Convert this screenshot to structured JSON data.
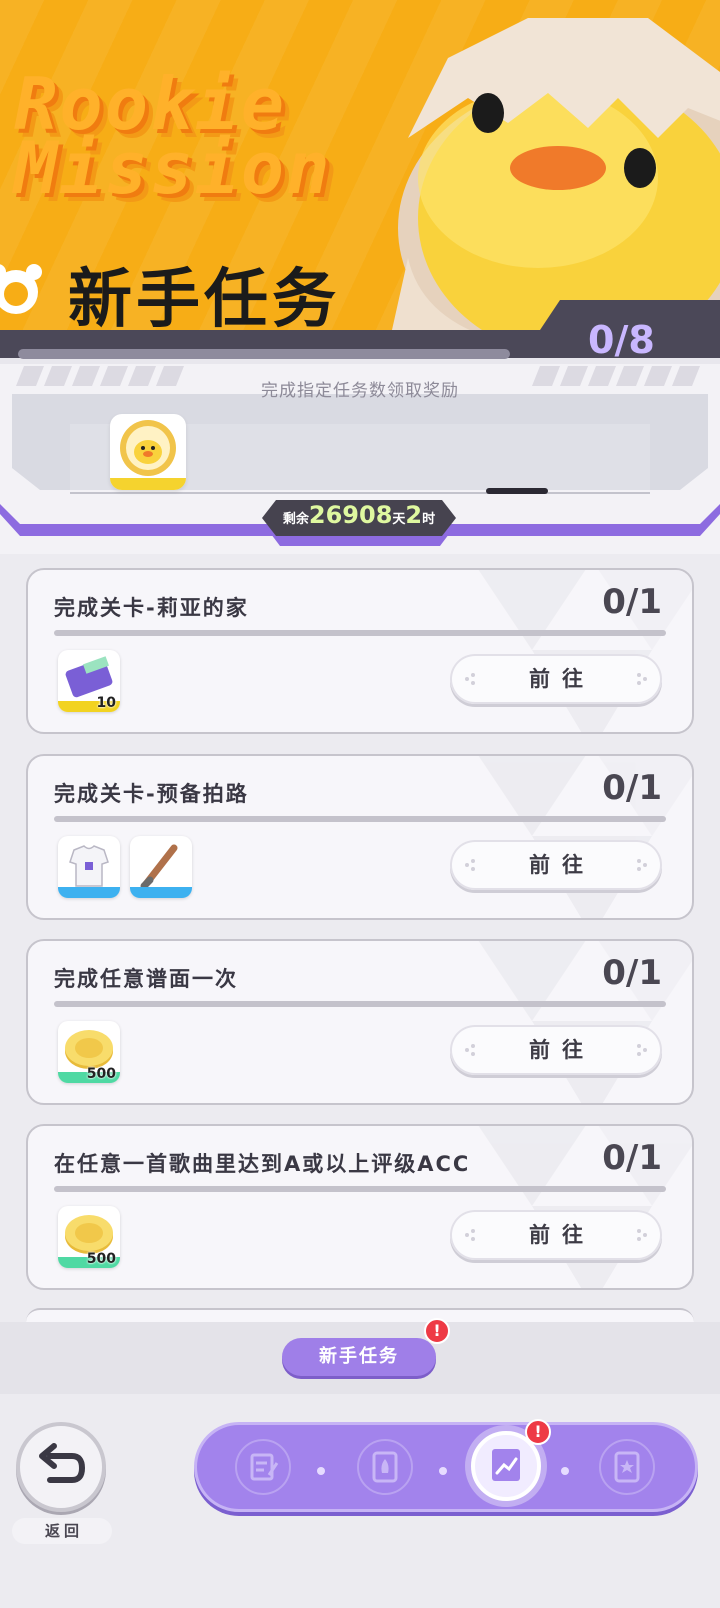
{
  "hero": {
    "title_en": "Rookie Mission",
    "title_cn": "新手任务",
    "progress": "0/8",
    "progress_fraction": 0.0
  },
  "panel": {
    "hint": "完成指定任务数领取奖励",
    "timer_prefix": "剩余",
    "timer_days": "26908",
    "timer_days_unit": "天",
    "timer_hours": "2",
    "timer_hours_unit": "时"
  },
  "tasks": [
    {
      "title": "完成关卡-莉亚的家",
      "progress": "0/1",
      "button": "前往",
      "rewards": [
        {
          "icon": "ticket-icon",
          "qty": "10",
          "stripe": "#f2d321"
        }
      ]
    },
    {
      "title": "完成关卡-预备拍路",
      "progress": "0/1",
      "button": "前往",
      "rewards": [
        {
          "icon": "shirt-icon",
          "qty": "",
          "stripe": "#3db1f0"
        },
        {
          "icon": "bat-icon",
          "qty": "",
          "stripe": "#3db1f0"
        }
      ]
    },
    {
      "title": "完成任意谱面一次",
      "progress": "0/1",
      "button": "前往",
      "rewards": [
        {
          "icon": "coin-icon",
          "qty": "500",
          "stripe": "#4fd9a3"
        }
      ]
    },
    {
      "title": "在任意一首歌曲里达到A或以上评级ACC",
      "progress": "0/1",
      "button": "前往",
      "rewards": [
        {
          "icon": "coin-icon",
          "qty": "500",
          "stripe": "#4fd9a3"
        }
      ]
    }
  ],
  "tab_chip": {
    "label": "新手任务",
    "badge": "!"
  },
  "back": {
    "label": "返回"
  },
  "nav": {
    "items": [
      {
        "icon": "task-list-icon",
        "active": false
      },
      {
        "icon": "rocket-icon",
        "active": false
      },
      {
        "icon": "growth-chart-icon",
        "active": true,
        "badge": "!"
      },
      {
        "icon": "star-clipboard-icon",
        "active": false
      }
    ]
  },
  "colors": {
    "hero_bg": "#f7ad16",
    "accent_purple": "#a283ec",
    "badge_red": "#ee3a45"
  }
}
